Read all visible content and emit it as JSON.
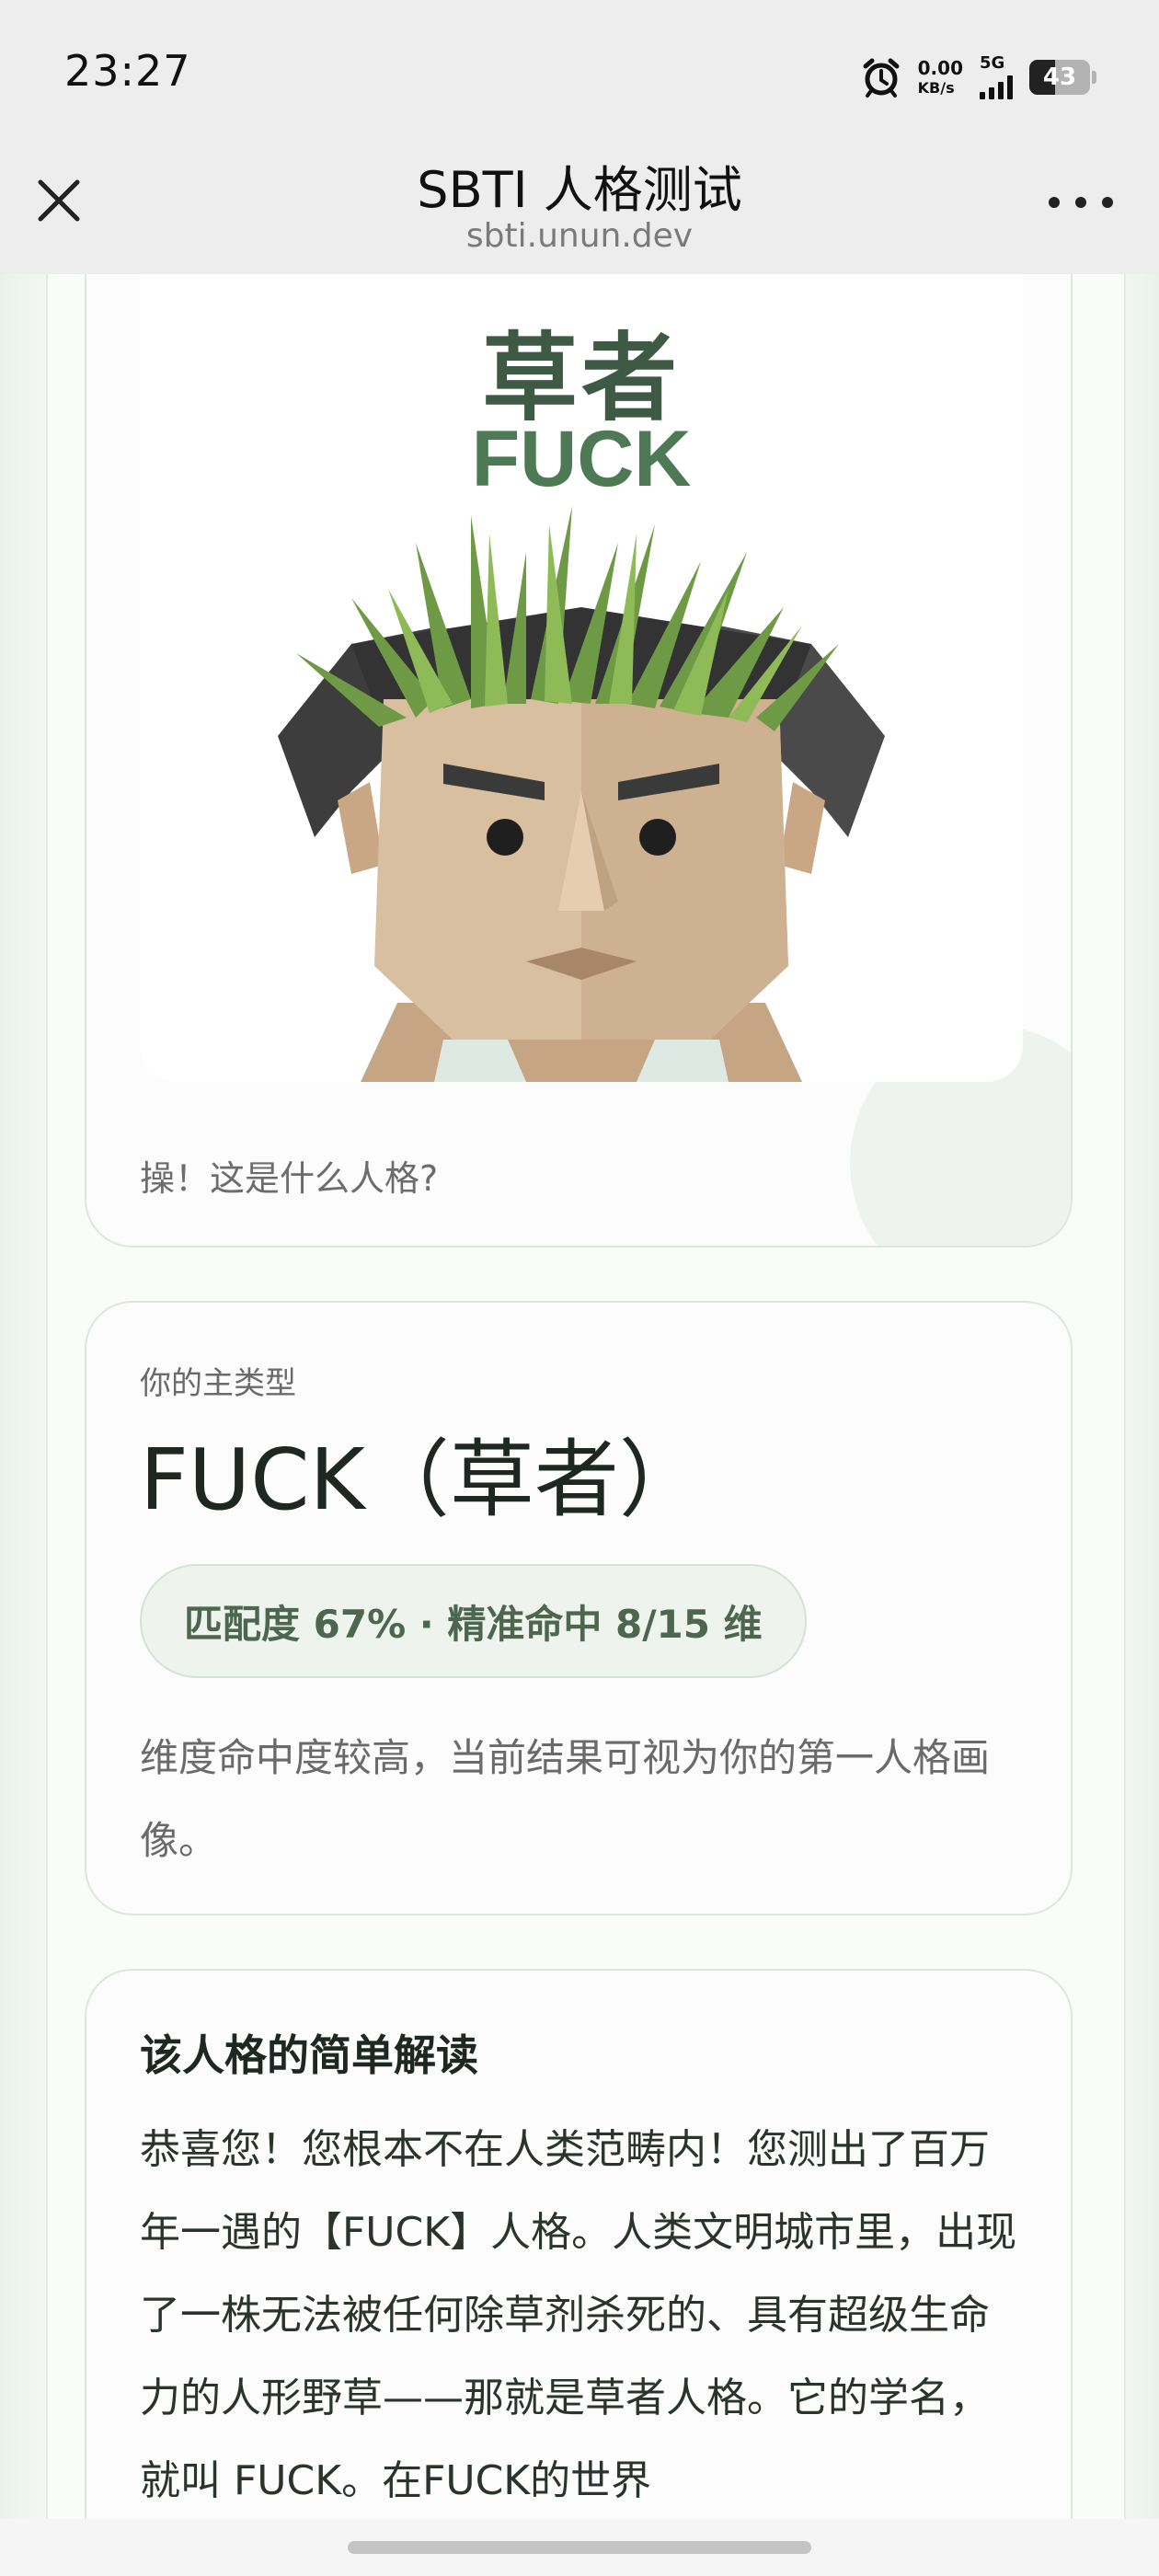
{
  "status_bar": {
    "time": "23:27",
    "net_speed_value": "0.00",
    "net_speed_unit": "KB/s",
    "network_type": "5G",
    "battery_level": "43",
    "battery_percent": 43
  },
  "nav": {
    "title": "SBTI 人格测试",
    "subtitle": "sbti.unun.dev"
  },
  "portrait": {
    "title_cn": "草者",
    "title_en": "FUCK",
    "caption": "操！这是什么人格?"
  },
  "main_type": {
    "label": "你的主类型",
    "name": "FUCK（草者）",
    "match": "匹配度 67% · 精准命中 8/15 维",
    "description": "维度命中度较高，当前结果可视为你的第一人格画像。"
  },
  "interpretation": {
    "heading": "该人格的简单解读",
    "body": "恭喜您！您根本不在人类范畴内！您测出了百万年一遇的【FUCK】人格。人类文明城市里，出现了一株无法被任何除草剂杀死的、具有超级生命力的人形野草——那就是草者人格。它的学名，就叫 FUCK。在FUCK的世界"
  },
  "colors": {
    "accent_green": "#4d7a55",
    "pill_bg": "#eef3ee",
    "card_border": "#dde7de"
  },
  "icons": {
    "close": "close-icon",
    "more": "more-icon",
    "alarm": "alarm-icon"
  }
}
